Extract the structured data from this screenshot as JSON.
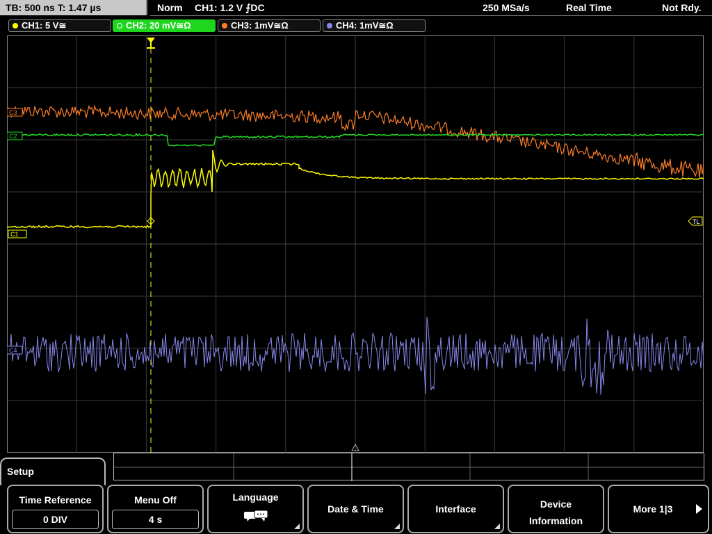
{
  "status_bar": {
    "timebase": "TB: 500 ns   T: 1.47 µs",
    "trigger_mode": "Norm",
    "trigger_info": "CH1: 1.2 V ⨍DC",
    "sample_rate": "250 MSa/s",
    "acq_mode": "Real Time",
    "status": "Not Rdy."
  },
  "channels": [
    {
      "label": "CH1: 5 V≅",
      "color": "#ffff00"
    },
    {
      "label": "CH2: 20 mV≅Ω",
      "color": "#22dd22"
    },
    {
      "label": "CH3: 1mV≅Ω",
      "color": "#ff7f27"
    },
    {
      "label": "CH4: 1mV≅Ω",
      "color": "#8888ee"
    }
  ],
  "markers": {
    "c1": "C1",
    "c2": "C2",
    "c3": "C3",
    "c4": "C4",
    "trigger_level": "TL"
  },
  "setup_label": "Setup",
  "softkeys": [
    {
      "title": "Time Reference",
      "value": "0 DIV"
    },
    {
      "title": "Menu Off",
      "value": "4 s"
    },
    {
      "title": "Language",
      "icon": "speech-bubbles-icon"
    },
    {
      "title": "Date & Time"
    },
    {
      "title": "Interface"
    },
    {
      "title": "Device",
      "title2": "Information"
    },
    {
      "title": "More 1|3"
    }
  ]
}
